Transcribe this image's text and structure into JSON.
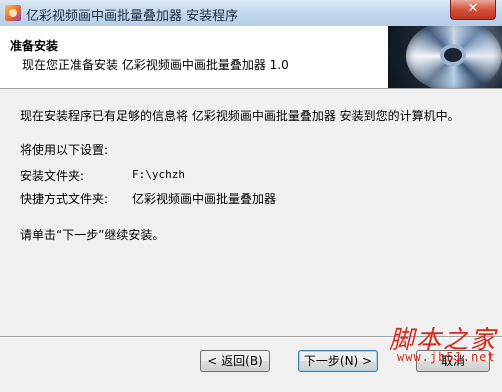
{
  "window": {
    "title": "亿彩视频画中画批量叠加器 安装程序",
    "close_glyph": "✕"
  },
  "header": {
    "title": "准备安装",
    "subtitle": "现在您正准备安装 亿彩视频画中画批量叠加器 1.0"
  },
  "body": {
    "intro": "现在安装程序已有足够的信息将 亿彩视频画中画批量叠加器 安装到您的计算机中。",
    "settings_heading": "将使用以下设置:",
    "settings": [
      {
        "label": "安装文件夹:",
        "value": "F:\\ychzh"
      },
      {
        "label": "快捷方式文件夹:",
        "value": "亿彩视频画中画批量叠加器"
      }
    ],
    "instruction": "请单击“下一步”继续安装。"
  },
  "buttons": {
    "back": "< 返回(B)",
    "next": "下一步(N) >",
    "cancel": "取消"
  },
  "watermark": {
    "main": "脚本之家",
    "url": "www.jb51.net"
  },
  "colors": {
    "titlebar": "#c3d7ee",
    "dialog_bg": "#f0f0f0",
    "close_button": "#c2351f",
    "watermark": "#d42a1c"
  }
}
